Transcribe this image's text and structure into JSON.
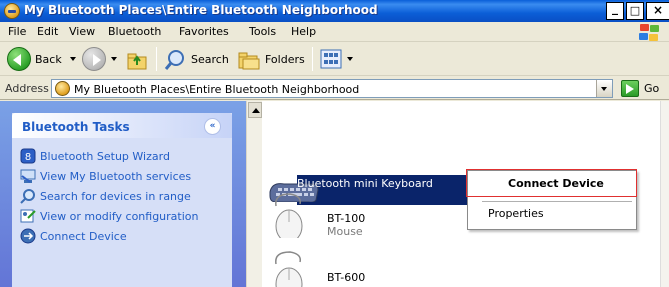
{
  "window": {
    "title": "My Bluetooth Places\\Entire Bluetooth Neighborhood",
    "buttons": {
      "minimize": "_",
      "maximize": "□",
      "close": "×"
    }
  },
  "menubar": {
    "items": [
      "File",
      "Edit",
      "View",
      "Bluetooth",
      "Favorites",
      "Tools",
      "Help"
    ]
  },
  "toolbar": {
    "back_label": "Back",
    "search_label": "Search",
    "folders_label": "Folders"
  },
  "address": {
    "label": "Address",
    "value": "My Bluetooth Places\\Entire Bluetooth Neighborhood",
    "go_label": "Go"
  },
  "taskpane": {
    "title": "Bluetooth Tasks",
    "collapse_glyph": "«",
    "tasks": [
      {
        "label": "Bluetooth Setup Wizard",
        "icon": "bluetooth-wizard-icon"
      },
      {
        "label": "View My Bluetooth services",
        "icon": "services-icon"
      },
      {
        "label": "Search for devices in range",
        "icon": "search-icon"
      },
      {
        "label": "View or modify configuration",
        "icon": "configuration-icon"
      },
      {
        "label": "Connect Device",
        "icon": "connect-device-icon"
      }
    ]
  },
  "devices": [
    {
      "name": "Bluetooth mini Keyboard",
      "subtitle": "",
      "selected": true,
      "icon": "keyboard-icon"
    },
    {
      "name": "BT-100",
      "subtitle": "Mouse",
      "selected": false,
      "icon": "mouse-icon"
    },
    {
      "name": "BT-600",
      "subtitle": "",
      "selected": false,
      "icon": "mouse-icon"
    }
  ],
  "context_menu": {
    "items": [
      {
        "label": "Connect Device",
        "default": true
      },
      {
        "label": "Properties",
        "default": false
      }
    ],
    "highlight_color": "#e03030"
  },
  "colors": {
    "title_bar": "#0a5fd8",
    "task_link": "#215dc6",
    "selection": "#0a246a"
  }
}
